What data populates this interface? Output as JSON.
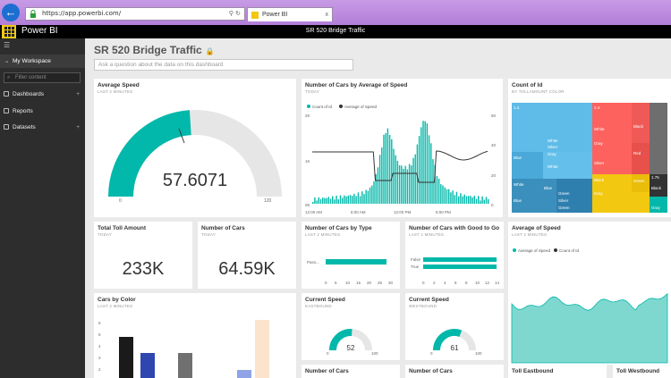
{
  "browser": {
    "url": "https://app.powerbi.com/",
    "tab_title": "Power BI",
    "tab_close": "x"
  },
  "header": {
    "brand": "Power BI",
    "title": "SR 520 Bridge Traffic"
  },
  "sidebar": {
    "workspace": "My Workspace",
    "filter_placeholder": "Filter content",
    "items": [
      {
        "label": "Dashboards"
      },
      {
        "label": "Reports"
      },
      {
        "label": "Datasets"
      }
    ]
  },
  "dashboard": {
    "title": "SR 520 Bridge Traffic",
    "qa_placeholder": "Ask a question about the data on this dashboard"
  },
  "tiles": {
    "avg_speed": {
      "title": "Average Speed",
      "subtitle": "LAST 2 MINUTES",
      "value": "57.6071",
      "min": "0",
      "max": "120",
      "gauge_fraction": 0.48
    },
    "cars_by_avg_speed": {
      "title": "Number of Cars by Average of Speed",
      "subtitle": "TODAY",
      "legend": [
        "Count of Id",
        "Average of Speed"
      ],
      "y_left": [
        "2K",
        "1K",
        "0K"
      ],
      "y_right": [
        "60",
        "40",
        "20",
        "0"
      ],
      "x_ticks": [
        "12:00 AM",
        "6:00 AM",
        "12:00 PM",
        "6:00 PM"
      ]
    },
    "count_of_id": {
      "title": "Count of Id",
      "subtitle": "BY TOLLAMOUNT COLOR",
      "labels": [
        "1.4",
        "2.4",
        "1.75",
        "White",
        "White",
        "Gray",
        "Silver",
        "Black",
        "White",
        "Blue",
        "Green",
        "Red",
        "Silver",
        "Black",
        "Gray",
        "Green",
        "Blue",
        "White",
        "Black",
        "Gray",
        "Silver",
        "Blue",
        "Green",
        "Gray"
      ]
    },
    "total_toll": {
      "title": "Total Toll Amount",
      "subtitle": "TODAY",
      "value": "233K"
    },
    "num_cars": {
      "title": "Number of Cars",
      "subtitle": "TODAY",
      "value": "64.59K"
    },
    "cars_by_type": {
      "title": "Number of Cars by Type",
      "subtitle": "LAST 2 MINUTES",
      "categories": [
        "Pass..."
      ],
      "x_ticks": [
        "0",
        "5",
        "10",
        "15",
        "20",
        "25",
        "30"
      ]
    },
    "cars_good_to_go": {
      "title": "Number of Cars with Good to Go",
      "subtitle": "LAST 2 MINUTES",
      "categories": [
        "False",
        "True"
      ],
      "x_ticks": [
        "0",
        "2",
        "4",
        "6",
        "8",
        "10",
        "12",
        "14"
      ]
    },
    "avg_speed_line": {
      "title": "Average of Speed",
      "subtitle": "LAST 2 MINUTES",
      "legend": [
        "Average of Speed",
        "Count of Id"
      ]
    },
    "cars_by_color": {
      "title": "Cars by Color",
      "subtitle": "LAST 2 MINUTES",
      "y_ticks": [
        "6",
        "5",
        "4",
        "3",
        "2"
      ]
    },
    "current_speed_east": {
      "title": "Current Speed",
      "subtitle": "EASTBOUND",
      "value": "52",
      "min": "0",
      "max": "100",
      "fraction": 0.52
    },
    "current_speed_west": {
      "title": "Current Speed",
      "subtitle": "WESTBOUND",
      "value": "61",
      "min": "0",
      "max": "100",
      "fraction": 0.61
    },
    "bottom": [
      {
        "title": "Number of Cars"
      },
      {
        "title": "Number of Cars"
      },
      {
        "title": "Toll Eastbound"
      },
      {
        "title": "Toll Westbound"
      }
    ]
  },
  "colors": {
    "teal": "#01b8aa",
    "black": "#1a1a1a",
    "yellow": "#f2c811",
    "red": "#fd625e",
    "blue": "#5fbbe8",
    "gauge_bg": "#e6e6e6"
  }
}
